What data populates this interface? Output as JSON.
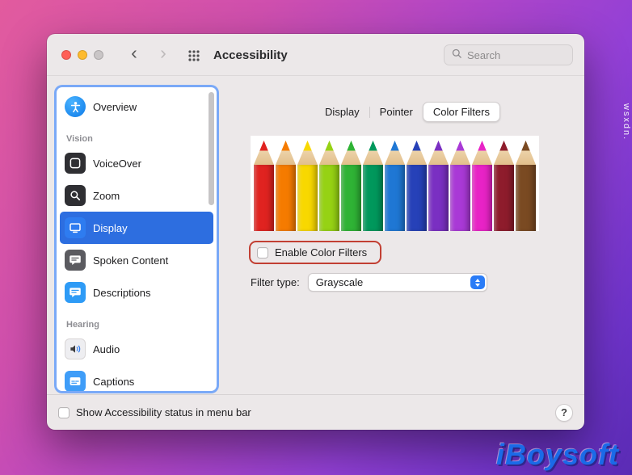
{
  "window": {
    "title": "Accessibility",
    "search_placeholder": "Search"
  },
  "sidebar": {
    "sections": {
      "vision": "Vision",
      "hearing": "Hearing"
    },
    "items": {
      "overview": "Overview",
      "voiceover": "VoiceOver",
      "zoom": "Zoom",
      "display": "Display",
      "spoken_content": "Spoken Content",
      "descriptions": "Descriptions",
      "audio": "Audio",
      "captions": "Captions"
    },
    "selected_item": "Display"
  },
  "main": {
    "tabs": {
      "display": "Display",
      "pointer": "Pointer",
      "color_filters": "Color Filters"
    },
    "selected_tab": "Color Filters",
    "pencil_image": {
      "description": "row of colored pencils",
      "colors": [
        "#e02320",
        "#f57b00",
        "#f8d800",
        "#96d214",
        "#2fb335",
        "#00985c",
        "#1f77d4",
        "#2641b8",
        "#7a2fc2",
        "#a939d6",
        "#e823c6",
        "#8e1c2c",
        "#7a4a22"
      ]
    },
    "enable_checkbox": {
      "label": "Enable Color Filters",
      "checked": false
    },
    "filter_type": {
      "label": "Filter type:",
      "value": "Grayscale"
    }
  },
  "footer": {
    "status_checkbox": {
      "label": "Show Accessibility status in menu bar",
      "checked": false
    },
    "help_label": "?"
  },
  "watermarks": {
    "side": "wsxdn.",
    "brand": "iBoysoft"
  },
  "colors": {
    "selection_blue": "#2d6ee0",
    "annotation_red": "#c23f33",
    "popup_accent": "#2a7cf7",
    "focus_ring": "#7aa9f7",
    "brand_blue": "#1a6ae8"
  }
}
